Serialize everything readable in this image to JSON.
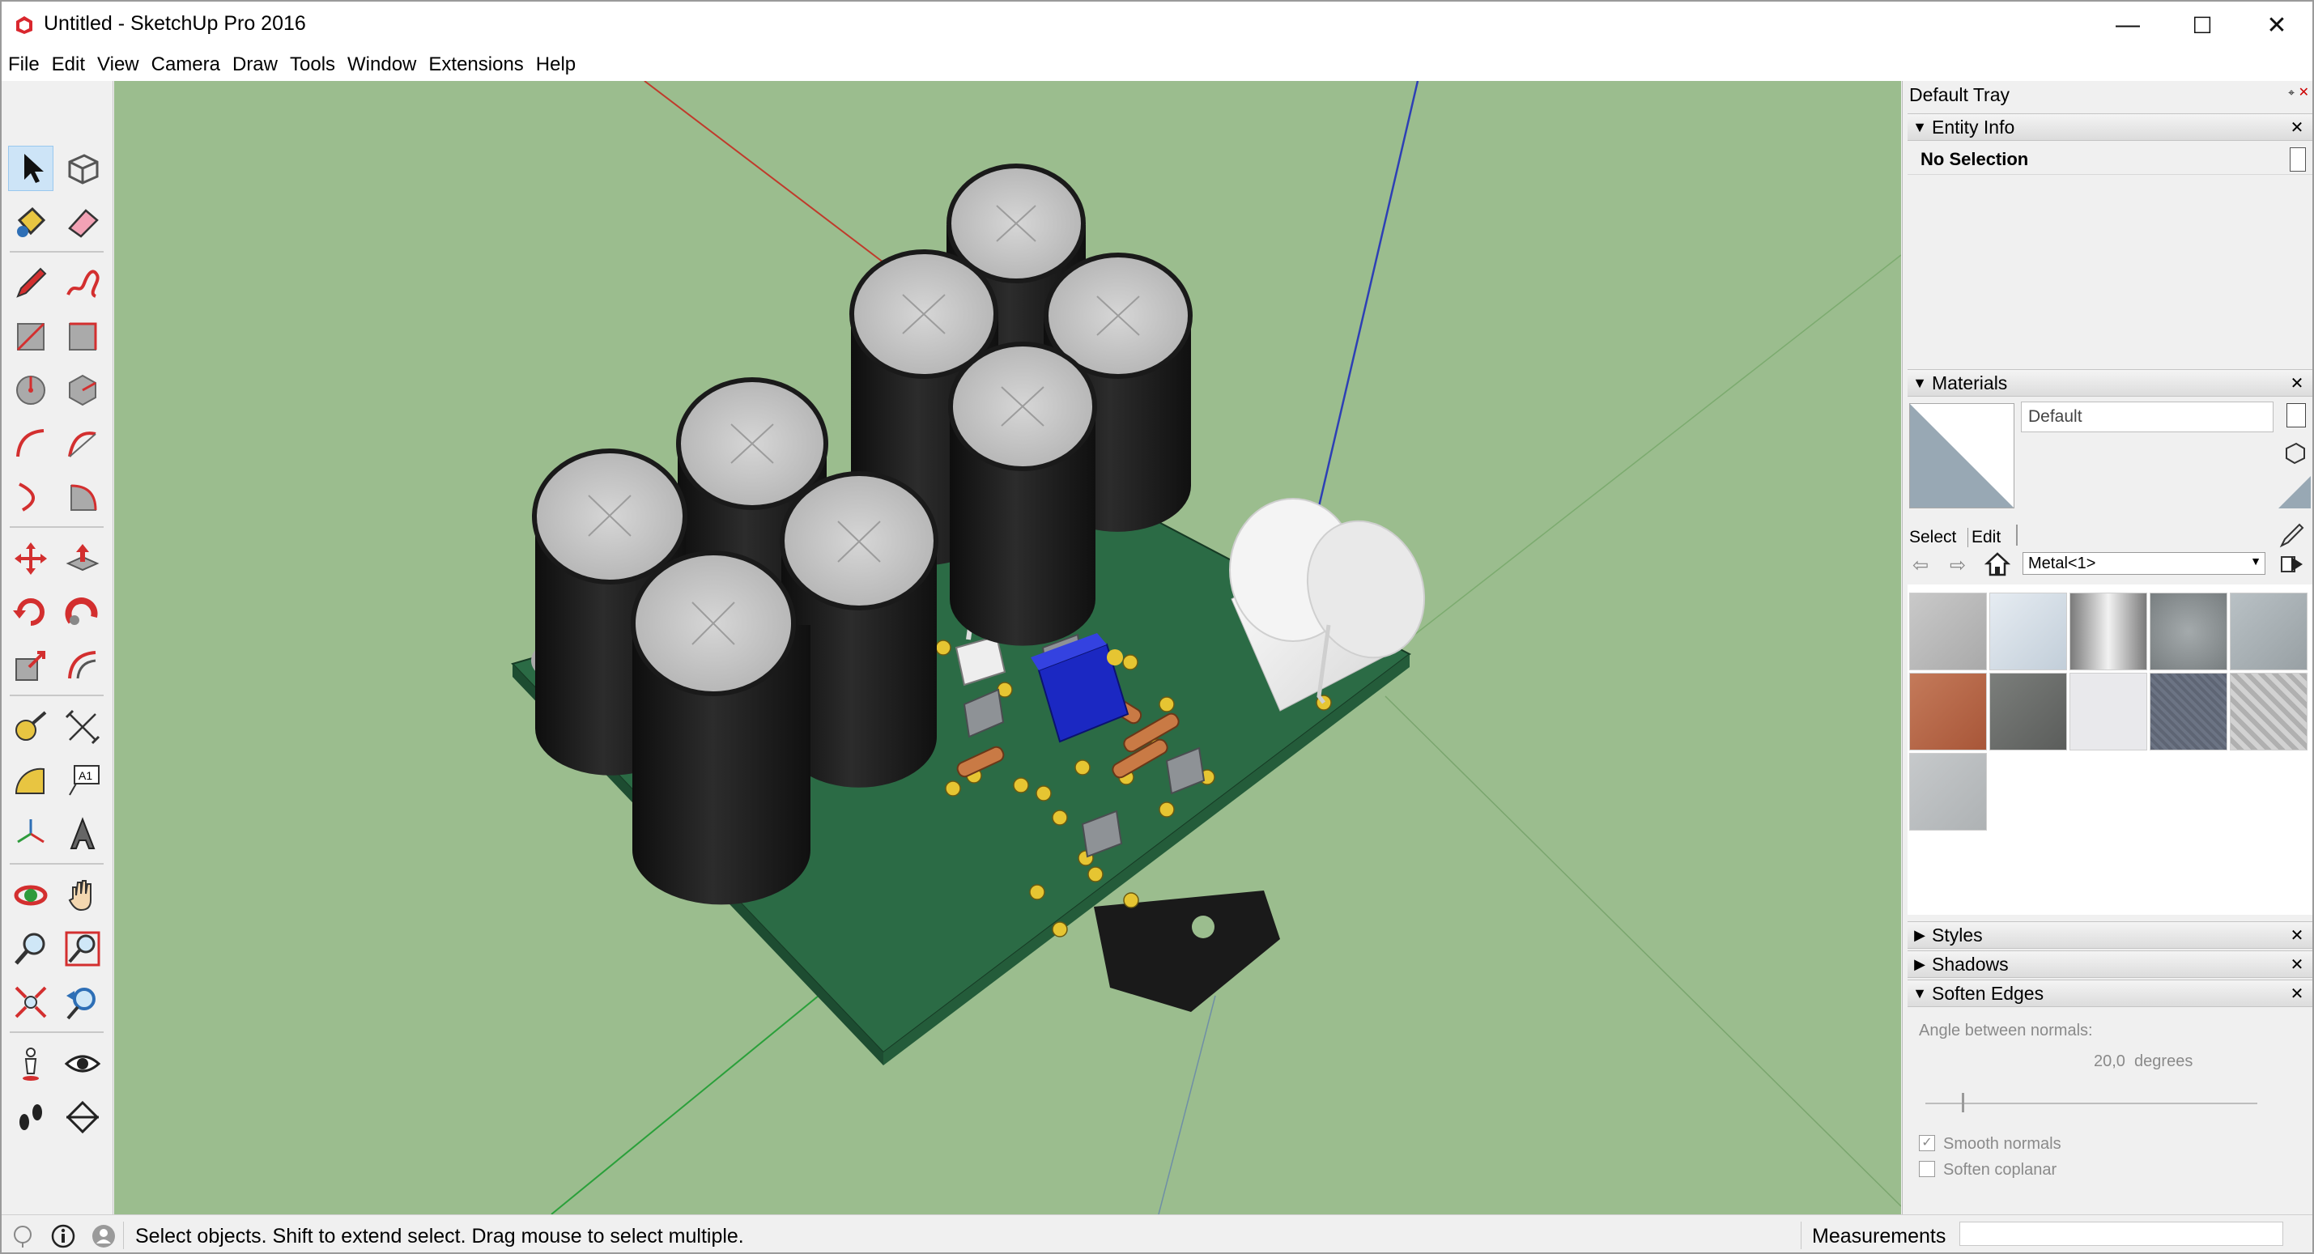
{
  "window": {
    "title": "Untitled - SketchUp Pro 2016",
    "minimize": "—",
    "maximize": "☐",
    "close": "✕"
  },
  "menu": [
    "File",
    "Edit",
    "View",
    "Camera",
    "Draw",
    "Tools",
    "Window",
    "Extensions",
    "Help"
  ],
  "tray": {
    "title": "Default Tray",
    "entity_info": {
      "label": "Entity Info",
      "selection": "No Selection"
    },
    "materials": {
      "label": "Materials",
      "current_name": "Default",
      "tab_select": "Select",
      "tab_edit": "Edit",
      "library": "Metal<1>",
      "swatch_colors": [
        "#b9b9b9",
        "#d3dde6",
        "#9b9b9b",
        "#8e9496",
        "#a9b1b5",
        "#b36548",
        "#6b6d6b",
        "#e9e9ec",
        "#5e6574",
        "#c6c6c6",
        "#bcbfc1"
      ]
    },
    "styles_label": "Styles",
    "shadows_label": "Shadows",
    "soften_edges": {
      "label": "Soften Edges",
      "angle_label": "Angle between normals:",
      "angle_value": "20,0  degrees",
      "angle_fraction": 0.11,
      "smooth_normals": "Smooth normals",
      "smooth_normals_checked": true,
      "soften_coplanar": "Soften coplanar",
      "soften_coplanar_checked": false
    }
  },
  "status": {
    "hint": "Select objects. Shift to extend select. Drag mouse to select multiple.",
    "measurements_label": "Measurements",
    "measurements_value": ""
  },
  "tools": [
    "select",
    "make-component",
    "paint-bucket",
    "eraser",
    "line",
    "freehand",
    "rectangle",
    "rotated-rectangle",
    "circle",
    "polygon",
    "arc",
    "2-point-arc",
    "3-point-arc",
    "pie",
    "move",
    "push-pull",
    "rotate",
    "follow-me",
    "scale",
    "offset",
    "tape-measure",
    "dimension",
    "protractor",
    "text",
    "axes",
    "3d-text",
    "orbit",
    "pan",
    "zoom",
    "zoom-window",
    "zoom-extents",
    "previous",
    "position-camera",
    "look-around",
    "walk",
    "section-plane"
  ],
  "colors": {
    "sky_ground": "#9bbd8e",
    "pcb": "#2b6b45",
    "capacitor": "#1e1e1e",
    "cap_top": "#c8c8c8",
    "accent": "#cde4f7"
  }
}
